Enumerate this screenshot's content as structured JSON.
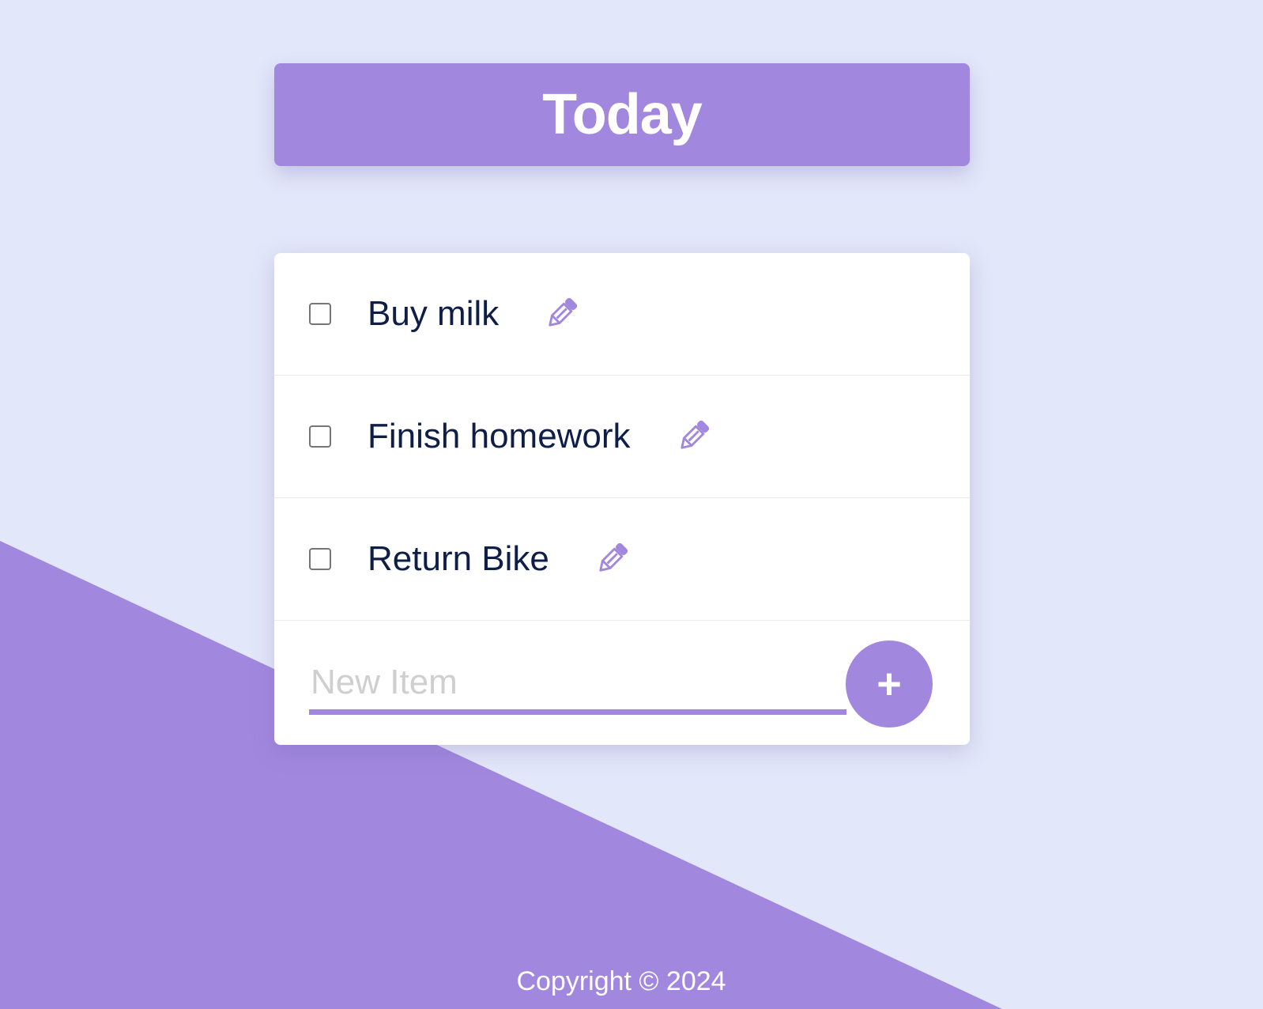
{
  "heading": {
    "title": "Today"
  },
  "todo_list": {
    "items": [
      {
        "text": "Buy milk",
        "checked": false,
        "edit_icon": "pencil-icon"
      },
      {
        "text": "Finish homework",
        "checked": false,
        "edit_icon": "pencil-icon"
      },
      {
        "text": "Return Bike",
        "checked": false,
        "edit_icon": "pencil-icon"
      }
    ],
    "new_item": {
      "value": "",
      "placeholder": "New Item"
    },
    "add_button": {
      "label": "+"
    }
  },
  "footer": {
    "text": "Copyright © 2024"
  },
  "colors": {
    "background": "#E3E7FA",
    "accent": "#A287DE",
    "card": "#FFFFFF",
    "item_text": "#0E1E47",
    "placeholder": "#CFCFCF"
  }
}
